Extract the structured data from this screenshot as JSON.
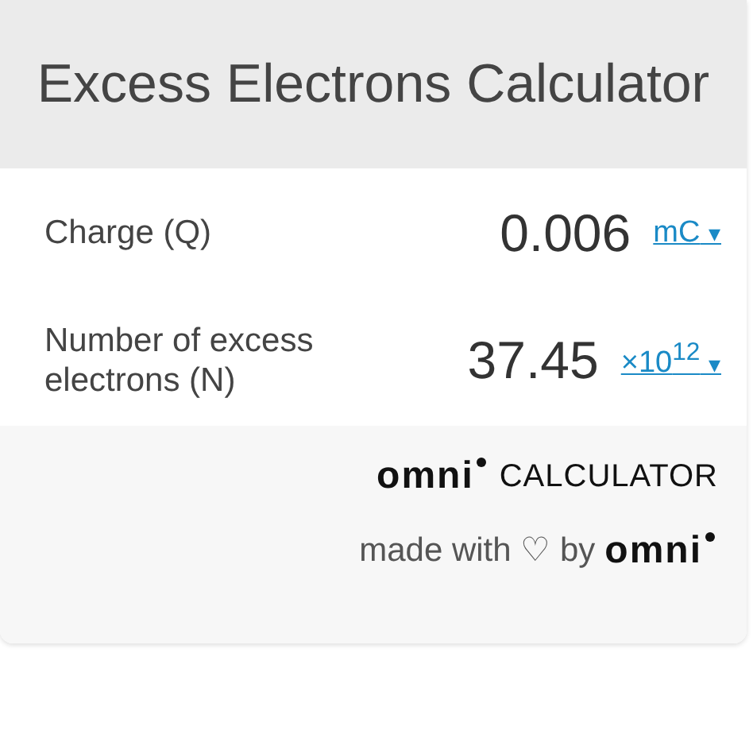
{
  "title": "Excess Electrons Calculator",
  "fields": [
    {
      "label": "Charge (Q)",
      "value": "0.006",
      "unit": "mC",
      "caret": "▾"
    },
    {
      "label": "Number of excess electrons (N)",
      "value": "37.45",
      "unit": "×10$^{12}$",
      "caret": "▾"
    }
  ],
  "footer": {
    "logo": "omni",
    "logo_suffix": "CALCULATOR",
    "credit": "made with ♡ by",
    "credit_logo": "omni"
  }
}
